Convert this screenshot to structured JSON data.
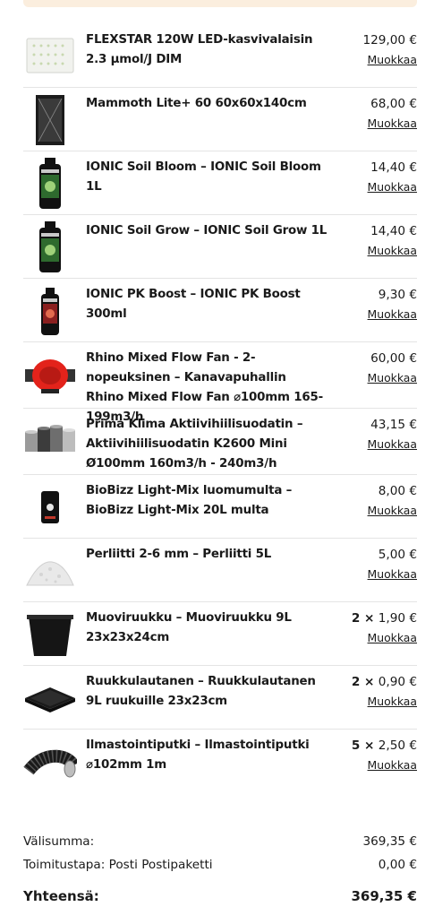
{
  "cart": {
    "edit_label": "Muokkaa",
    "items": [
      {
        "name": "FLEXSTAR 120W LED-kasvivalaisin 2.3 μmol/J DIM",
        "quantity": "",
        "price": "129,00 €",
        "image": "led-panel"
      },
      {
        "name": "Mammoth Lite+ 60 60x60x140cm",
        "quantity": "",
        "price": "68,00 €",
        "image": "grow-tent"
      },
      {
        "name": "IONIC Soil Bloom – IONIC Soil Bloom 1L",
        "quantity": "",
        "price": "14,40 €",
        "image": "nutrient-bottle"
      },
      {
        "name": "IONIC Soil Grow – IONIC Soil Grow 1L",
        "quantity": "",
        "price": "14,40 €",
        "image": "nutrient-bottle"
      },
      {
        "name": "IONIC PK Boost – IONIC PK Boost 300ml",
        "quantity": "",
        "price": "9,30 €",
        "image": "nutrient-bottle-small"
      },
      {
        "name": "Rhino Mixed Flow Fan - 2-nopeuksinen – Kanavapuhallin Rhino Mixed Flow Fan ⌀100mm 165-199m3/h",
        "quantity": "",
        "price": "60,00 €",
        "image": "duct-fan"
      },
      {
        "name": "Prima Klima Aktiivihiilisuodatin – Aktiivihiilisuodatin K2600 Mini Ø100mm 160m3/h - 240m3/h",
        "quantity": "",
        "price": "43,15 €",
        "image": "carbon-filters"
      },
      {
        "name": "BioBizz Light-Mix luomumulta – BioBizz Light-Mix 20L multa",
        "quantity": "",
        "price": "8,00 €",
        "image": "soil-bag"
      },
      {
        "name": "Perliitti 2-6 mm – Perliitti 5L",
        "quantity": "",
        "price": "5,00 €",
        "image": "perlite"
      },
      {
        "name": "Muoviruukku – Muoviruukku 9L 23x23x24cm",
        "quantity": "2 ×",
        "price": "1,90 €",
        "image": "plastic-pot"
      },
      {
        "name": "Ruukkulautanen – Ruukkulautanen 9L ruukuille 23x23cm",
        "quantity": "2 ×",
        "price": "0,90 €",
        "image": "pot-saucer"
      },
      {
        "name": "Ilmastointiputki – Ilmastointiputki ⌀102mm 1m",
        "quantity": "5 ×",
        "price": "2,50 €",
        "image": "ducting-hose"
      }
    ]
  },
  "totals": {
    "subtotal_label": "Välisumma:",
    "subtotal_value": "369,35 €",
    "shipping_label": "Toimitustapa: Posti Postipaketti",
    "shipping_value": "0,00 €",
    "total_label": "Yhteensä:",
    "total_value": "369,35 €"
  }
}
